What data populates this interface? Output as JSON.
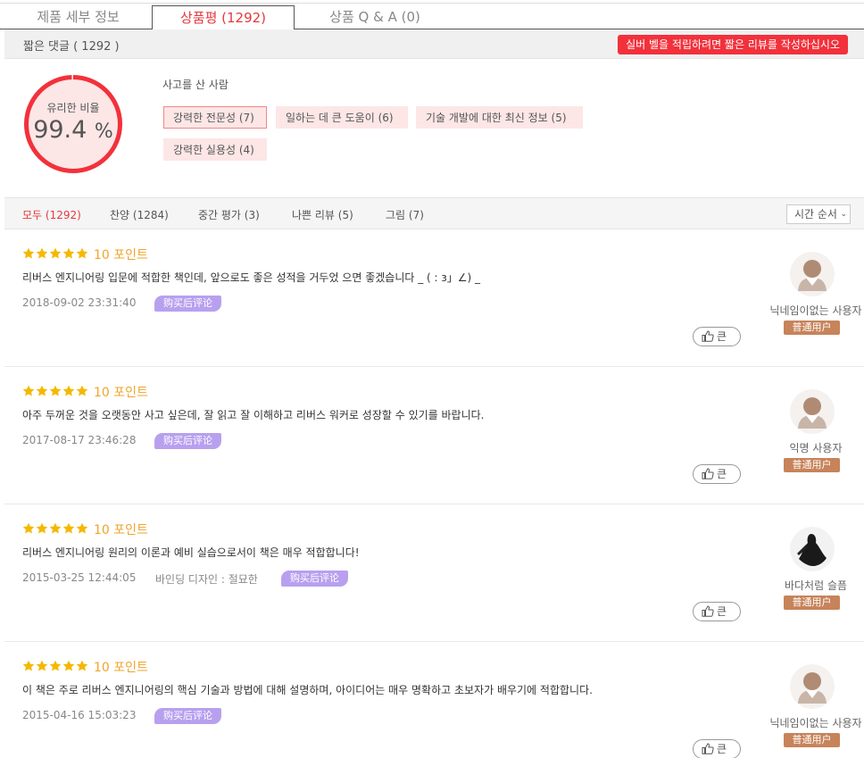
{
  "tabs": [
    {
      "label": "제품 세부 정보"
    },
    {
      "label": "상품평 (1292)"
    },
    {
      "label": "상품 Q & A (0)"
    }
  ],
  "short_comments": {
    "label": "짧은 댓글 ( 1292 )",
    "notice": "실버 벨을 적립하려면 짧은 리뷰를 작성하십시오"
  },
  "rating": {
    "label": "유리한 비율",
    "value": "99.4",
    "unit": "%",
    "ratio": 0.994
  },
  "buyers": {
    "title": "사고를 산 사람",
    "tags": [
      {
        "label": "강력한 전문성 (7)"
      },
      {
        "label": "일하는 데 큰 도움이 (6)"
      },
      {
        "label": "기술 개발에 대한 최신 정보 (5)"
      },
      {
        "label": "강력한 실용성 (4)"
      }
    ]
  },
  "filters": [
    {
      "label": "모두 (1292)"
    },
    {
      "label": "찬양 (1284)"
    },
    {
      "label": "중간 평가 (3)"
    },
    {
      "label": "나쁜 리뷰 (5)"
    },
    {
      "label": "그림 (7)"
    }
  ],
  "sort": {
    "label": "시간 순서"
  },
  "reviews": [
    {
      "stars": 5,
      "points": "10 포인트",
      "text": "리버스 엔지니어링 입문에 적합한 책인데, 앞으로도 좋은 성적을 거두었 으면 좋겠습니다 _ ( : з」∠) _",
      "date": "2018-09-02 23:31:40",
      "extra": "",
      "badge": "购买后评论",
      "like": "큰",
      "user": "닉네임이없는 사용자",
      "level": "普通用户"
    },
    {
      "stars": 5,
      "points": "10 포인트",
      "text": "아주 두꺼운 것을 오랫동안 사고 싶은데, 잘 읽고 잘 이해하고 리버스 워커로 성장할 수 있기를 바랍니다.",
      "date": "2017-08-17 23:46:28",
      "extra": "",
      "badge": "购买后评论",
      "like": "큰",
      "user": "익명 사용자",
      "level": "普通用户"
    },
    {
      "stars": 5,
      "points": "10 포인트",
      "text": "리버스 엔지니어링 원리의 이론과 예비 실습으로서이 책은 매우 적합합니다!",
      "date": "2015-03-25 12:44:05",
      "extra": "바인딩 디자인 : 절묘한",
      "badge": "购买后评论",
      "like": "큰",
      "user": "바다처럼 슬픔",
      "level": "普通用户"
    },
    {
      "stars": 5,
      "points": "10 포인트",
      "text": "이 책은 주로 리버스 엔지니어링의 핵심 기술과 방법에 대해 설명하며, 아이디어는 매우 명확하고 초보자가 배우기에 적합합니다.",
      "date": "2015-04-16 15:03:23",
      "extra": "",
      "badge": "购买后评论",
      "like": "큰",
      "user": "닉네임이없는 사용자",
      "level": "普通用户"
    }
  ],
  "colors": {
    "accent": "#e4393c",
    "ring": "#f2313b",
    "star": "#f5b800",
    "badge": "#b8a0ef",
    "level": "#c7835a"
  }
}
